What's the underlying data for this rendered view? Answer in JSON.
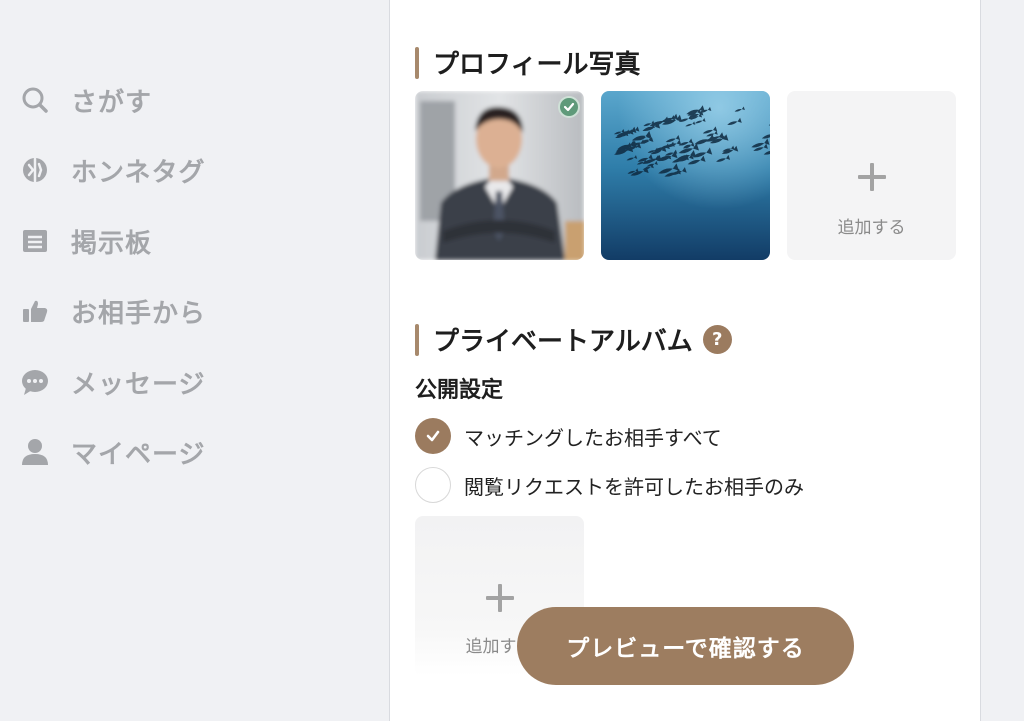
{
  "sidebar": {
    "items": [
      {
        "label": "さがす",
        "icon": "search-icon"
      },
      {
        "label": "ホンネタグ",
        "icon": "tag-icon"
      },
      {
        "label": "掲示板",
        "icon": "board-icon"
      },
      {
        "label": "お相手から",
        "icon": "thumbs-up-icon"
      },
      {
        "label": "メッセージ",
        "icon": "chat-bubble-icon"
      },
      {
        "label": "マイページ",
        "icon": "person-icon"
      }
    ]
  },
  "profile_photos": {
    "title": "プロフィール写真",
    "add_label": "追加する",
    "photos": [
      {
        "subject": "man-in-suit",
        "selected": true
      },
      {
        "subject": "school-of-fish",
        "selected": false
      }
    ]
  },
  "private_album": {
    "title": "プライベートアルバム",
    "help_badge": "?",
    "visibility_heading": "公開設定",
    "options": [
      {
        "label": "マッチングしたお相手すべて",
        "selected": true
      },
      {
        "label": "閲覧リクエストを許可したお相手のみ",
        "selected": false
      }
    ],
    "add_label": "追加する"
  },
  "cta": {
    "label": "プレビューで確認する"
  },
  "colors": {
    "accent": "#9b7b5f",
    "section_bar": "#a7896c",
    "check_badge": "#5f9a7a",
    "nav_text": "#a4a6aa",
    "background": "#f0f1f4"
  }
}
